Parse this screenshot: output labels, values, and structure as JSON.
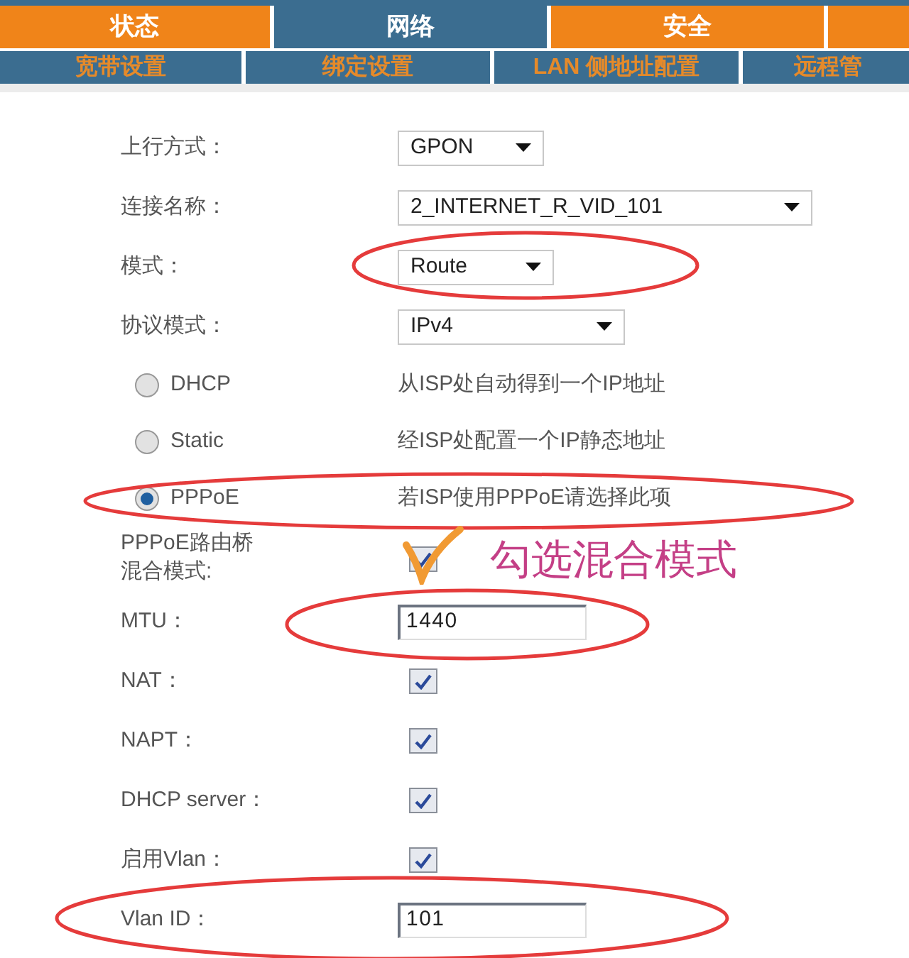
{
  "tabs": [
    {
      "label": "状态",
      "selected": false
    },
    {
      "label": "网络",
      "selected": true
    },
    {
      "label": "安全",
      "selected": false
    },
    {
      "selected": false
    }
  ],
  "subtabs": [
    {
      "label": "宽带设置"
    },
    {
      "label": "绑定设置"
    },
    {
      "label": "LAN 侧地址配置"
    },
    {
      "label": "远程管"
    }
  ],
  "fields": [
    {
      "kind": "select",
      "label": "上行方式：",
      "value": "GPON"
    },
    {
      "kind": "select",
      "label": "连接名称：",
      "value": "2_INTERNET_R_VID_101"
    },
    {
      "kind": "select",
      "label": "模式：",
      "value": "Route"
    },
    {
      "kind": "select",
      "label": "协议模式：",
      "value": "IPv4"
    },
    {
      "kind": "radio",
      "label": "DHCP",
      "description": "从ISP处自动得到一个IP地址",
      "selected": false
    },
    {
      "kind": "radio",
      "label": "Static",
      "description": "经ISP处配置一个IP静态地址",
      "selected": false
    },
    {
      "kind": "radio",
      "label": "PPPoE",
      "description": "若ISP使用PPPoE请选择此项",
      "selected": true
    },
    {
      "kind": "checkbox",
      "label_lines": [
        "PPPoE路由桥",
        "混合模式:"
      ],
      "checked": true
    },
    {
      "kind": "text",
      "label": "MTU：",
      "value": "1440"
    },
    {
      "kind": "checkbox",
      "label": "NAT：",
      "checked": true
    },
    {
      "kind": "checkbox",
      "label": "NAPT：",
      "checked": true
    },
    {
      "kind": "checkbox",
      "label": "DHCP server：",
      "checked": true
    },
    {
      "kind": "checkbox",
      "label": "启用Vlan：",
      "checked": true
    },
    {
      "kind": "text",
      "label": "Vlan ID：",
      "value": "101"
    }
  ],
  "annotation": {
    "note": "勾选混合模式"
  }
}
